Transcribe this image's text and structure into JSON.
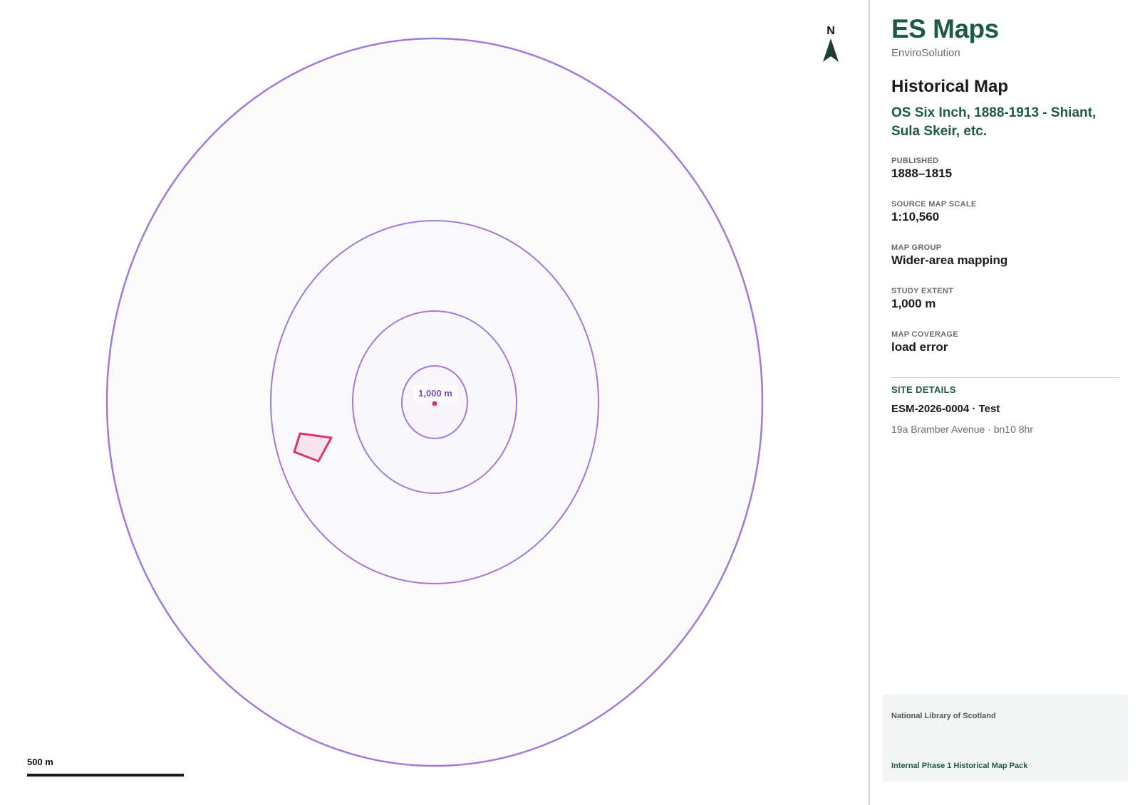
{
  "map": {
    "north_label": "N",
    "buffer_label": "1,000 m",
    "scale_bar_label": "500 m",
    "colors": {
      "buffer_stroke": "#a27ad6",
      "buffer_fill": "#f9f8fc",
      "site_stroke": "#d9386a",
      "site_fill": "#f7e4ec",
      "north_arrow": "#1d3d33"
    }
  },
  "panel": {
    "brand_title": "ES Maps",
    "brand_subtitle": "EnviroSolution",
    "section_title": "Historical Map",
    "map_name": "OS Six Inch, 1888-1913 - Shiant, Sula Skeir, etc.",
    "fields": [
      {
        "label": "PUBLISHED",
        "value": "1888–1815"
      },
      {
        "label": "SOURCE MAP SCALE",
        "value": "1:10,560"
      },
      {
        "label": "MAP GROUP",
        "value": "Wider-area mapping"
      },
      {
        "label": "STUDY EXTENT",
        "value": "1,000 m"
      },
      {
        "label": "MAP COVERAGE",
        "value": "load error"
      }
    ],
    "site_details_heading": "SITE DETAILS",
    "site_ref": "ESM-2026-0004 · Test",
    "site_address": "19a Bramber Avenue · bn10 8hr"
  },
  "footer": {
    "source": "National Library of Scotland",
    "pack": "Internal Phase 1 Historical Map Pack"
  }
}
